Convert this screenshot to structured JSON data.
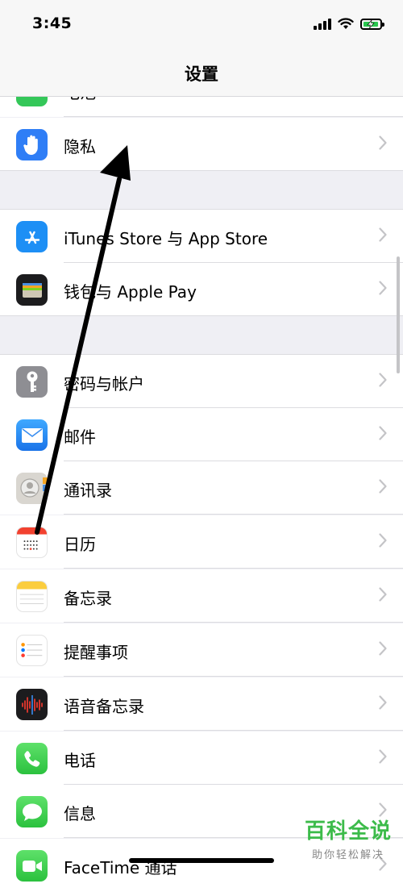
{
  "status_bar": {
    "time": "3:45"
  },
  "nav": {
    "title": "设置"
  },
  "rows": [
    {
      "label": "电池",
      "icon": "battery-settings-icon"
    },
    {
      "label": "隐私",
      "icon": "privacy-hand-icon"
    },
    {
      "label": "iTunes Store 与 App Store",
      "icon": "app-store-icon"
    },
    {
      "label": "钱包与 Apple Pay",
      "icon": "wallet-icon"
    },
    {
      "label": "密码与帐户",
      "icon": "key-icon"
    },
    {
      "label": "邮件",
      "icon": "mail-icon"
    },
    {
      "label": "通讯录",
      "icon": "contacts-icon"
    },
    {
      "label": "日历",
      "icon": "calendar-icon"
    },
    {
      "label": "备忘录",
      "icon": "notes-icon"
    },
    {
      "label": "提醒事项",
      "icon": "reminders-icon"
    },
    {
      "label": "语音备忘录",
      "icon": "voice-memos-icon"
    },
    {
      "label": "电话",
      "icon": "phone-icon"
    },
    {
      "label": "信息",
      "icon": "messages-icon"
    },
    {
      "label": "FaceTime 通话",
      "icon": "facetime-icon"
    }
  ],
  "watermark": {
    "main": "百科全说",
    "sub": "助你轻松解决"
  },
  "colors": {
    "accent_green": "#3cbb4a",
    "battery_green": "#2ac74f"
  }
}
